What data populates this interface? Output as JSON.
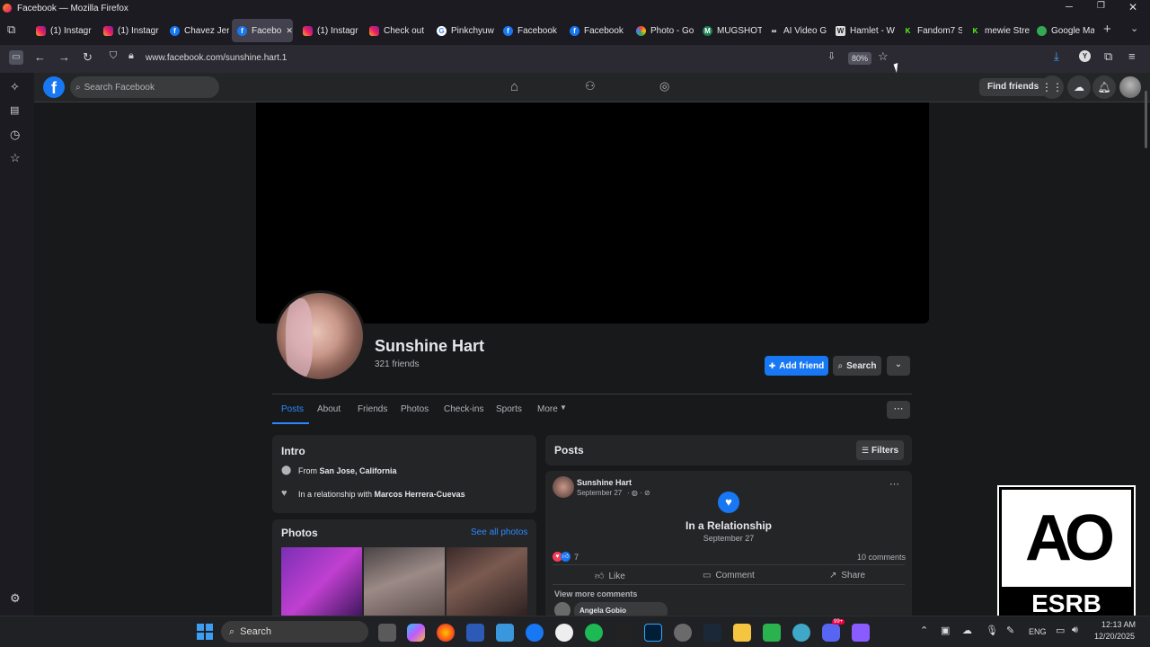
{
  "window": {
    "title": "Facebook — Mozilla Firefox"
  },
  "tabs": [
    {
      "label": "(1) Instagr",
      "icon": "instagram-icon"
    },
    {
      "label": "(1) Instagr",
      "icon": "instagram-icon"
    },
    {
      "label": "Chavez Jer",
      "icon": "facebook-icon"
    },
    {
      "label": "Facebo",
      "icon": "facebook-icon"
    },
    {
      "label": "(1) Instagr",
      "icon": "instagram-icon"
    },
    {
      "label": "Check out",
      "icon": "instagram-icon"
    },
    {
      "label": "Pinkchyuw",
      "icon": "google-icon"
    },
    {
      "label": "Facebook",
      "icon": "facebook-icon"
    },
    {
      "label": "Facebook",
      "icon": "facebook-icon"
    },
    {
      "label": "Photo - Go",
      "icon": "google-photos-icon"
    },
    {
      "label": "MUGSHOT",
      "icon": "mugshot-icon"
    },
    {
      "label": "AI Video G",
      "icon": "ai-video-icon"
    },
    {
      "label": "Hamlet - W",
      "icon": "wikipedia-icon"
    },
    {
      "label": "Fandom7 S",
      "icon": "kick-icon"
    },
    {
      "label": "mewie Stre",
      "icon": "kick-icon"
    },
    {
      "label": "Google Ma",
      "icon": "google-maps-icon"
    }
  ],
  "navbar": {
    "url": "www.facebook.com/sunshine.hart.1",
    "zoom": "80%"
  },
  "fb": {
    "search_placeholder": "Search Facebook",
    "find_friends": "Find friends",
    "profile": {
      "name": "Sunshine Hart",
      "friends": "321 friends"
    },
    "buttons": {
      "add_friend": "Add friend",
      "search": "Search"
    },
    "profile_tabs": [
      "Posts",
      "About",
      "Friends",
      "Photos",
      "Check-ins",
      "Sports",
      "More"
    ],
    "intro": {
      "title": "Intro",
      "from_prefix": "From ",
      "from_place": "San Jose, California",
      "rel_prefix": "In a relationship with ",
      "rel_name": "Marcos Herrera-Cuevas"
    },
    "photos": {
      "title": "Photos",
      "see_all": "See all photos"
    },
    "posts": {
      "title": "Posts",
      "filters": "Filters",
      "author": "Sunshine Hart",
      "date": "September 27",
      "event_title": "In a Relationship",
      "event_date": "September 27",
      "reactions": "7",
      "comments_count": "10 comments",
      "like": "Like",
      "comment": "Comment",
      "share": "Share",
      "view_more": "View more comments",
      "commenter": "Angela Gobio"
    }
  },
  "esrb": {
    "label": "ESRB",
    "rating": "AO"
  },
  "taskbar": {
    "search": "Search",
    "lang": "ENG",
    "time": "12:13 AM",
    "date": "12/20/2025",
    "badge": "99+"
  },
  "colors": {
    "fb_blue": "#1877f2",
    "bg": "#18191a",
    "card": "#242526"
  }
}
